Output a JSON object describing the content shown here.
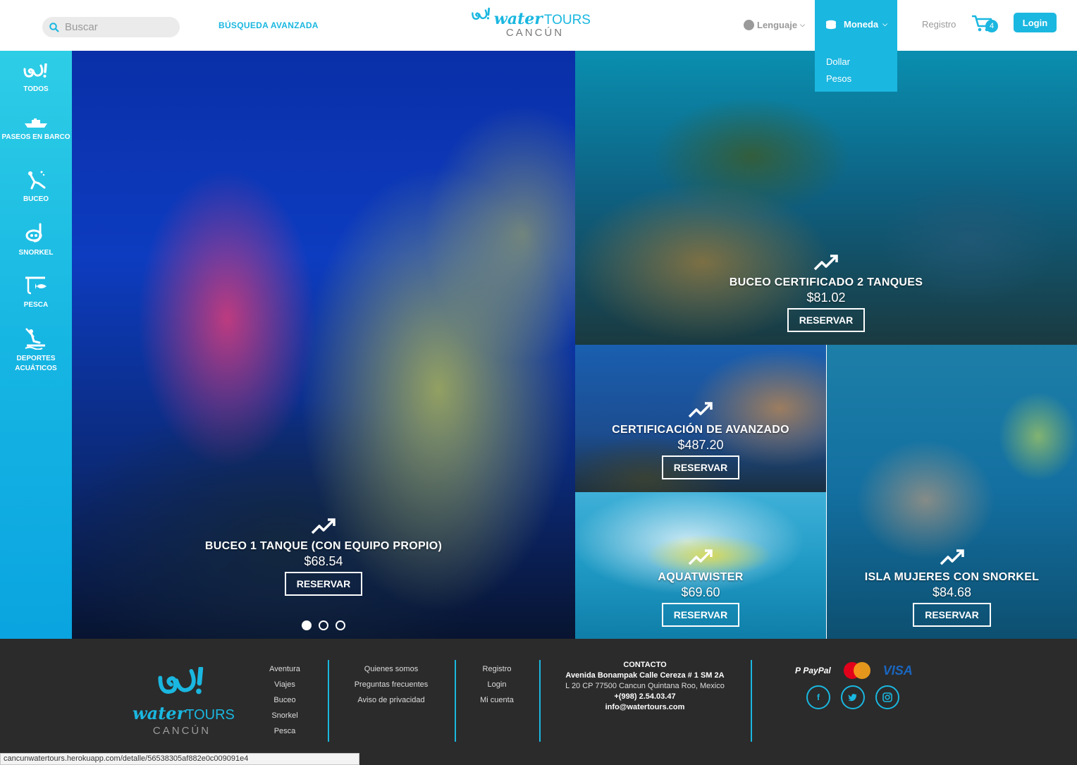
{
  "header": {
    "search_placeholder": "Buscar",
    "advanced_search": "BÚSQUEDA AVANZADA",
    "logo_water": "water",
    "logo_tours": "TOURS",
    "logo_city": "CANCÚN",
    "language": "Lenguaje",
    "currency": "Moneda",
    "currency_options": [
      "Dollar",
      "Pesos"
    ],
    "register": "Registro",
    "cart_count": "4",
    "login": "Login"
  },
  "sidebar": {
    "items": [
      {
        "label": "TODOS",
        "icon": "watertours-icon"
      },
      {
        "label": "PASEOS EN BARCO",
        "icon": "boat-icon"
      },
      {
        "label": "BUCEO",
        "icon": "diver-icon"
      },
      {
        "label": "SNORKEL",
        "icon": "snorkel-mask-icon"
      },
      {
        "label": "PESCA",
        "icon": "fishing-icon"
      },
      {
        "label": "DEPORTES ACUÁTICOS",
        "icon": "water-sports-icon"
      }
    ]
  },
  "tiles": [
    {
      "name": "BUCEO 1 TANQUE (CON EQUIPO PROPIO)",
      "price": "$68.54",
      "button": "RESERVAR"
    },
    {
      "name": "BUCEO CERTIFICADO 2 TANQUES",
      "price": "$81.02",
      "button": "RESERVAR"
    },
    {
      "name": "CERTIFICACIÓN DE AVANZADO",
      "price": "$487.20",
      "button": "RESERVAR"
    },
    {
      "name": "AQUATWISTER",
      "price": "$69.60",
      "button": "RESERVAR"
    },
    {
      "name": "ISLA MUJERES CON SNORKEL",
      "price": "$84.68",
      "button": "RESERVAR"
    }
  ],
  "carousel": {
    "active_index": 0,
    "count": 3
  },
  "footer": {
    "logo_water": "water",
    "logo_tours": "TOURS",
    "logo_city": "CANCÚN",
    "col1": [
      "Aventura",
      "Viajes",
      "Buceo",
      "Snorkel",
      "Pesca"
    ],
    "col2": [
      "Quienes somos",
      "Preguntas frecuentes",
      "Aviso de privacidad"
    ],
    "col3": [
      "Registro",
      "Login",
      "Mi cuenta"
    ],
    "contact": {
      "title": "CONTACTO",
      "address1": "Avenida Bonampak Calle Cereza # 1 SM 2A",
      "address2": "L 20 CP 77500 Cancun Quintana Roo, Mexico",
      "phone": "+(998) 2.54.03.47",
      "email": "info@watertours.com"
    },
    "payments": {
      "paypal": "PayPal",
      "mastercard": "MasterCard",
      "visa": "VISA"
    },
    "social": [
      "f",
      "t",
      "ig"
    ]
  },
  "status_url": "cancunwatertours.herokuapp.com/detalle/56538305af882e0c009091e4",
  "colors": {
    "accent": "#1ab7e0",
    "footer_bg": "#2b2b2b"
  }
}
